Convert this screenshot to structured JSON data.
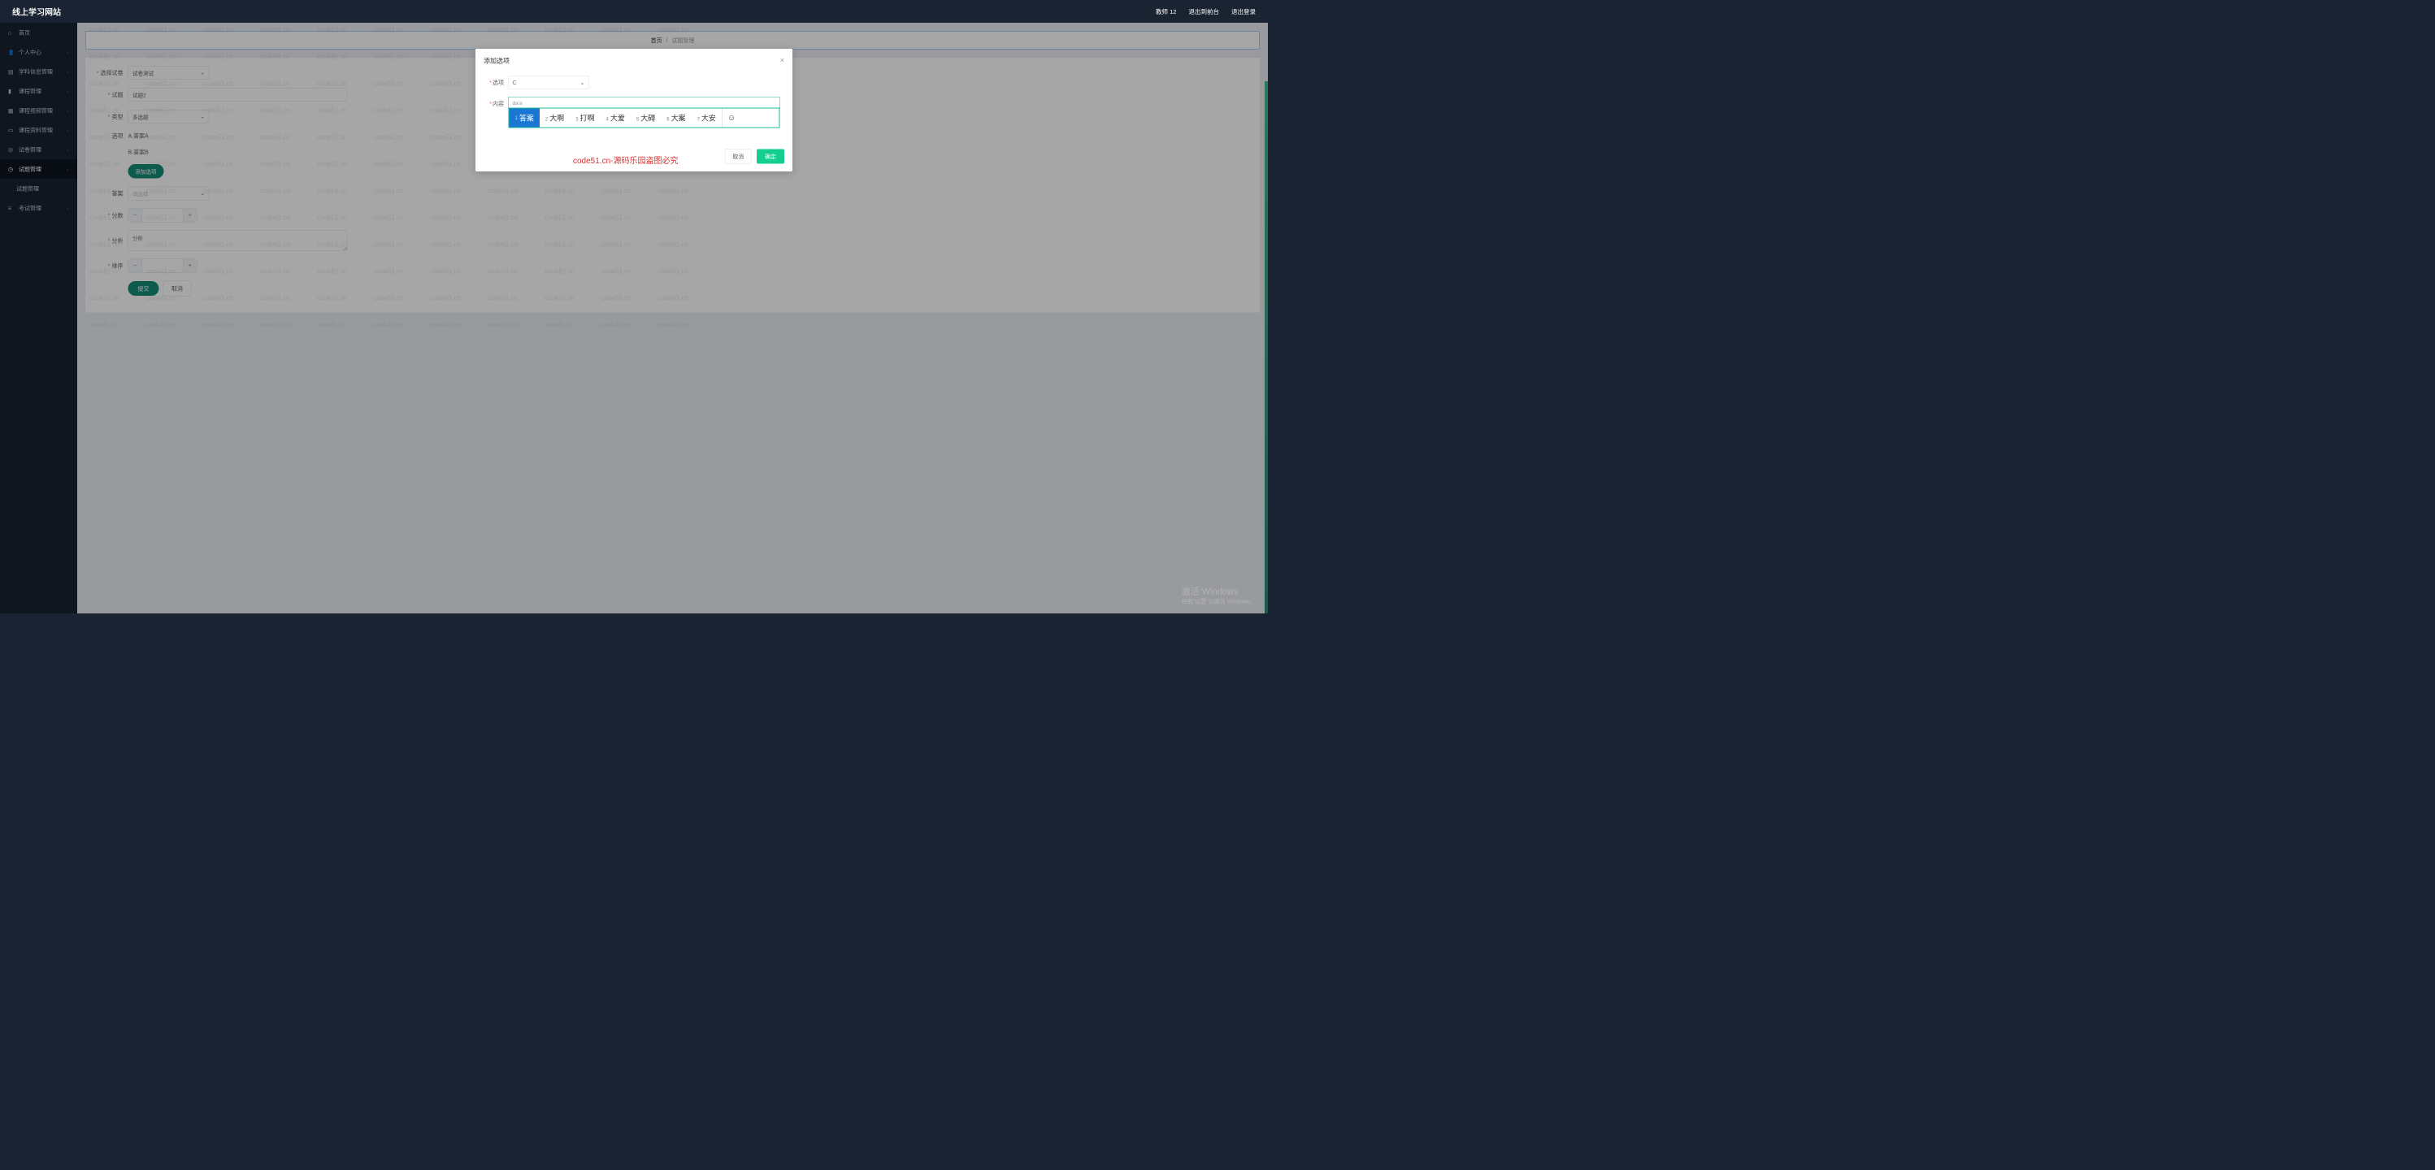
{
  "header": {
    "title": "线上学习网站",
    "user": "教师 12",
    "to_front": "退出到前台",
    "logout": "退出登录"
  },
  "sidebar": {
    "items": [
      {
        "label": "首页",
        "icon": "i-home",
        "expand": false
      },
      {
        "label": "个人中心",
        "icon": "i-user",
        "expand": true
      },
      {
        "label": "学科信息管理",
        "icon": "i-doc",
        "expand": true
      },
      {
        "label": "课程管理",
        "icon": "i-chart",
        "expand": true
      },
      {
        "label": "课程视频管理",
        "icon": "i-grid",
        "expand": true
      },
      {
        "label": "课程资料管理",
        "icon": "i-book",
        "expand": true
      },
      {
        "label": "试卷管理",
        "icon": "i-circle",
        "expand": true
      },
      {
        "label": "试题管理",
        "icon": "i-clock",
        "expand": true
      },
      {
        "label": "试题管理",
        "icon": "",
        "expand": false,
        "sub": true
      },
      {
        "label": "考试管理",
        "icon": "i-list",
        "expand": true
      }
    ]
  },
  "breadcrumb": {
    "home": "首页",
    "sep": "/",
    "current": "试题管理"
  },
  "form": {
    "paper_label": "选择试卷",
    "paper_value": "试卷测试",
    "question_label": "试题",
    "question_value": "试题2",
    "type_label": "类型",
    "type_value": "多选题",
    "options_label": "选项",
    "options": [
      {
        "key": "A",
        "text": "答案A"
      },
      {
        "key": "B",
        "text": "答案B"
      }
    ],
    "add_option": "添加选项",
    "answer_label": "答案",
    "answer_placeholder": "请选择",
    "score_label": "分数",
    "analysis_label": "分析",
    "analysis_placeholder": "分析",
    "order_label": "排序",
    "submit": "提交",
    "cancel": "取消"
  },
  "modal": {
    "title": "添加选项",
    "option_label": "选项",
    "option_value": "C",
    "content_label": "内容",
    "content_value": "da'a",
    "cancel": "取消",
    "ok": "确定"
  },
  "ime": {
    "candidates": [
      {
        "n": "1",
        "t": "答案"
      },
      {
        "n": "2",
        "t": "大啊"
      },
      {
        "n": "3",
        "t": "打啊"
      },
      {
        "n": "4",
        "t": "大爱"
      },
      {
        "n": "5",
        "t": "大碍"
      },
      {
        "n": "6",
        "t": "大案"
      },
      {
        "n": "7",
        "t": "大安"
      }
    ],
    "emoji": "☺"
  },
  "watermark": {
    "text": "code51.cn",
    "red": "code51.cn-源码乐园盗图必究"
  },
  "windows": {
    "l1": "激活 Windows",
    "l2": "转到\"设置\"以激活 Windows。"
  }
}
